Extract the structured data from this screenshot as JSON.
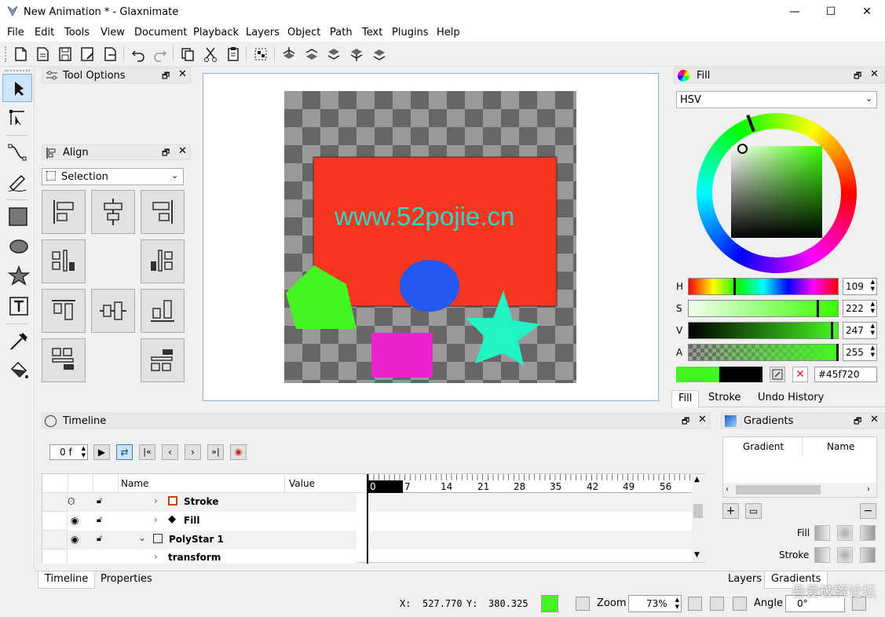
{
  "window": {
    "title": "New Animation * - Glaxnimate",
    "min": "—",
    "max": "☐",
    "close": "✕"
  },
  "menu": [
    "File",
    "Edit",
    "Tools",
    "View",
    "Document",
    "Playback",
    "Layers",
    "Object",
    "Path",
    "Text",
    "Plugins",
    "Help"
  ],
  "tool_options": {
    "title": "Tool Options"
  },
  "align": {
    "title": "Align",
    "selection": "Selection"
  },
  "canvas": {
    "watermark": "www.52pojie.cn",
    "colors": {
      "rect": "#f63620",
      "pentagon": "#45f720",
      "ellipse": "#2458f0",
      "magenta": "#ee22cc",
      "star": "#22f5c5"
    }
  },
  "fill_panel": {
    "title": "Fill",
    "mode": "HSV",
    "h_label": "H",
    "h_value": "109",
    "s_label": "S",
    "s_value": "222",
    "v_label": "V",
    "v_value": "247",
    "a_label": "A",
    "a_value": "255",
    "hex": "#45f720",
    "current_color": "#45f720",
    "tabs": [
      "Fill",
      "Stroke",
      "Undo History"
    ]
  },
  "timeline": {
    "title": "Timeline",
    "frame": "0 f",
    "col_name": "Name",
    "col_value": "Value",
    "ticks": [
      "0",
      "7",
      "14",
      "21",
      "28",
      "35",
      "42",
      "49",
      "56"
    ],
    "rows": [
      {
        "name": "Stroke"
      },
      {
        "name": "Fill"
      },
      {
        "name": "PolyStar 1"
      },
      {
        "name": "transform"
      }
    ],
    "tabs": [
      "Timeline",
      "Properties"
    ]
  },
  "gradients": {
    "title": "Gradients",
    "col_gradient": "Gradient",
    "col_name": "Name",
    "fill_label": "Fill",
    "stroke_label": "Stroke",
    "tabs": [
      "Layers",
      "Gradients"
    ]
  },
  "status": {
    "x_label": "X:",
    "x_value": "527.770",
    "y_label": "Y:",
    "y_value": "380.325",
    "zoom_label": "Zoom",
    "zoom_value": "73%",
    "angle_label": "Angle",
    "angle_value": "0°",
    "watermark": "吾爱破解论坛"
  }
}
